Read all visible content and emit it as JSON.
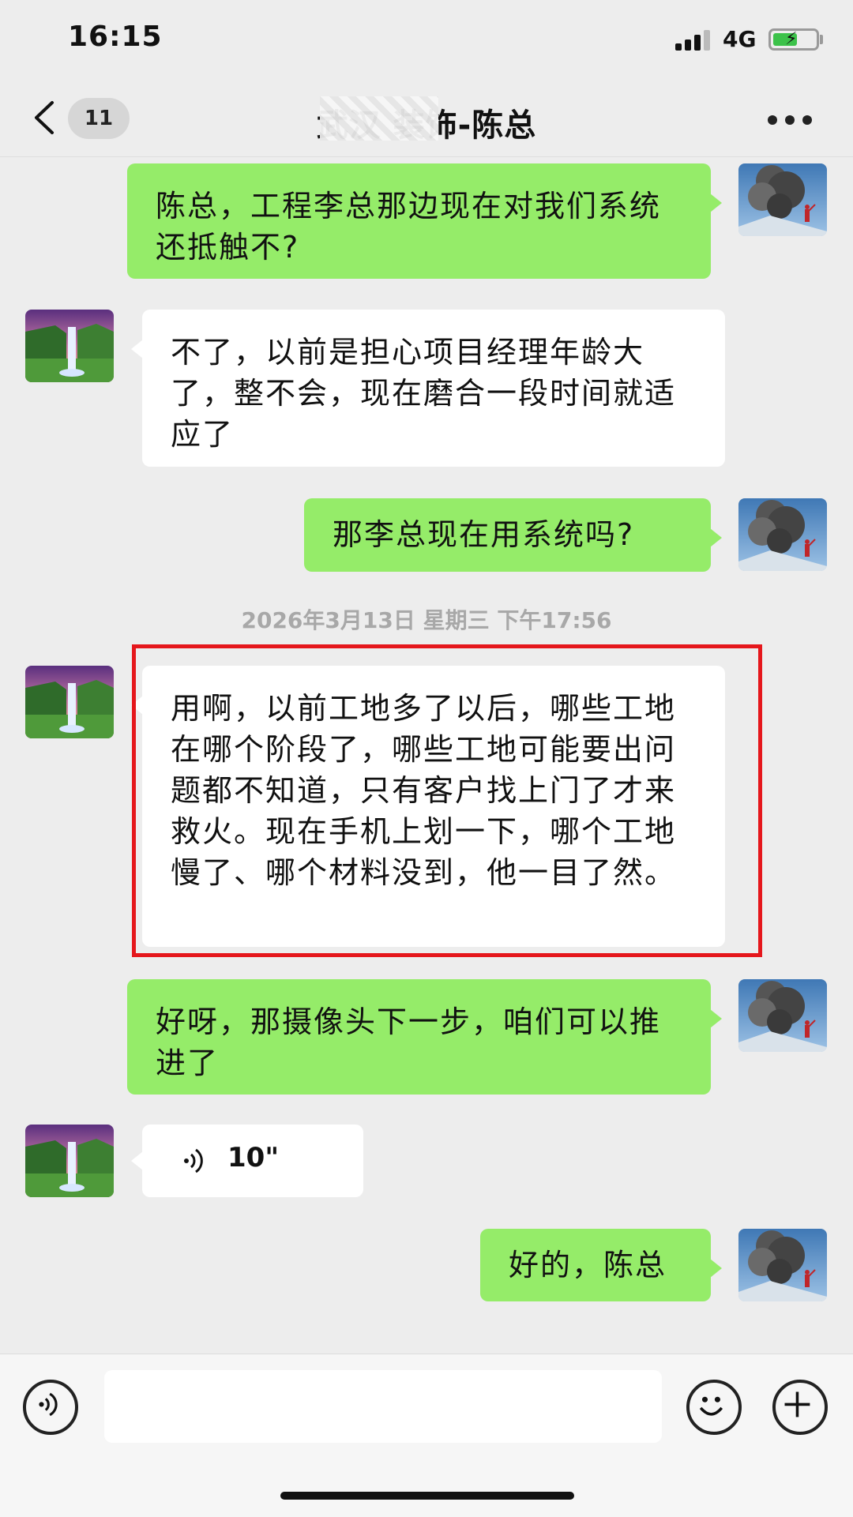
{
  "status_bar": {
    "time": "16:15",
    "network": "4G"
  },
  "nav": {
    "unread_count": "11",
    "title": "武汉        装饰-陈总"
  },
  "messages": [
    {
      "from": "me",
      "text": "陈总，工程李总那边现在对我们系统还抵触不?"
    },
    {
      "from": "other",
      "text": "不了，以前是担心项目经理年龄大了，整不会，现在磨合一段时间就适应了"
    },
    {
      "from": "me",
      "text": "那李总现在用系统吗?"
    },
    {
      "from": "other",
      "text": "用啊，以前工地多了以后，哪些工地在哪个阶段了，哪些工地可能要出问题都不知道，只有客户找上门了才来救火。现在手机上划一下，哪个工地慢了、哪个材料没到，他一目了然。"
    },
    {
      "from": "me",
      "text": "好呀，那摄像头下一步，咱们可以推进了"
    },
    {
      "from": "other",
      "type": "voice",
      "duration": "10\""
    },
    {
      "from": "me",
      "text": "好的，陈总"
    }
  ],
  "timestamp": "2026年3月13日 星期三 下午17:56",
  "input": {
    "value": "",
    "placeholder": ""
  },
  "icons": {
    "back": "chevron-left-icon",
    "more": "more-dots-icon",
    "voice_mode": "voice-icon",
    "emoji": "emoji-icon",
    "plus": "plus-icon",
    "voice_message": "voice-wave-icon"
  },
  "colors": {
    "my_bubble": "#95ec69",
    "other_bubble": "#ffffff",
    "background": "#ededed",
    "highlight": "#e5171c"
  }
}
